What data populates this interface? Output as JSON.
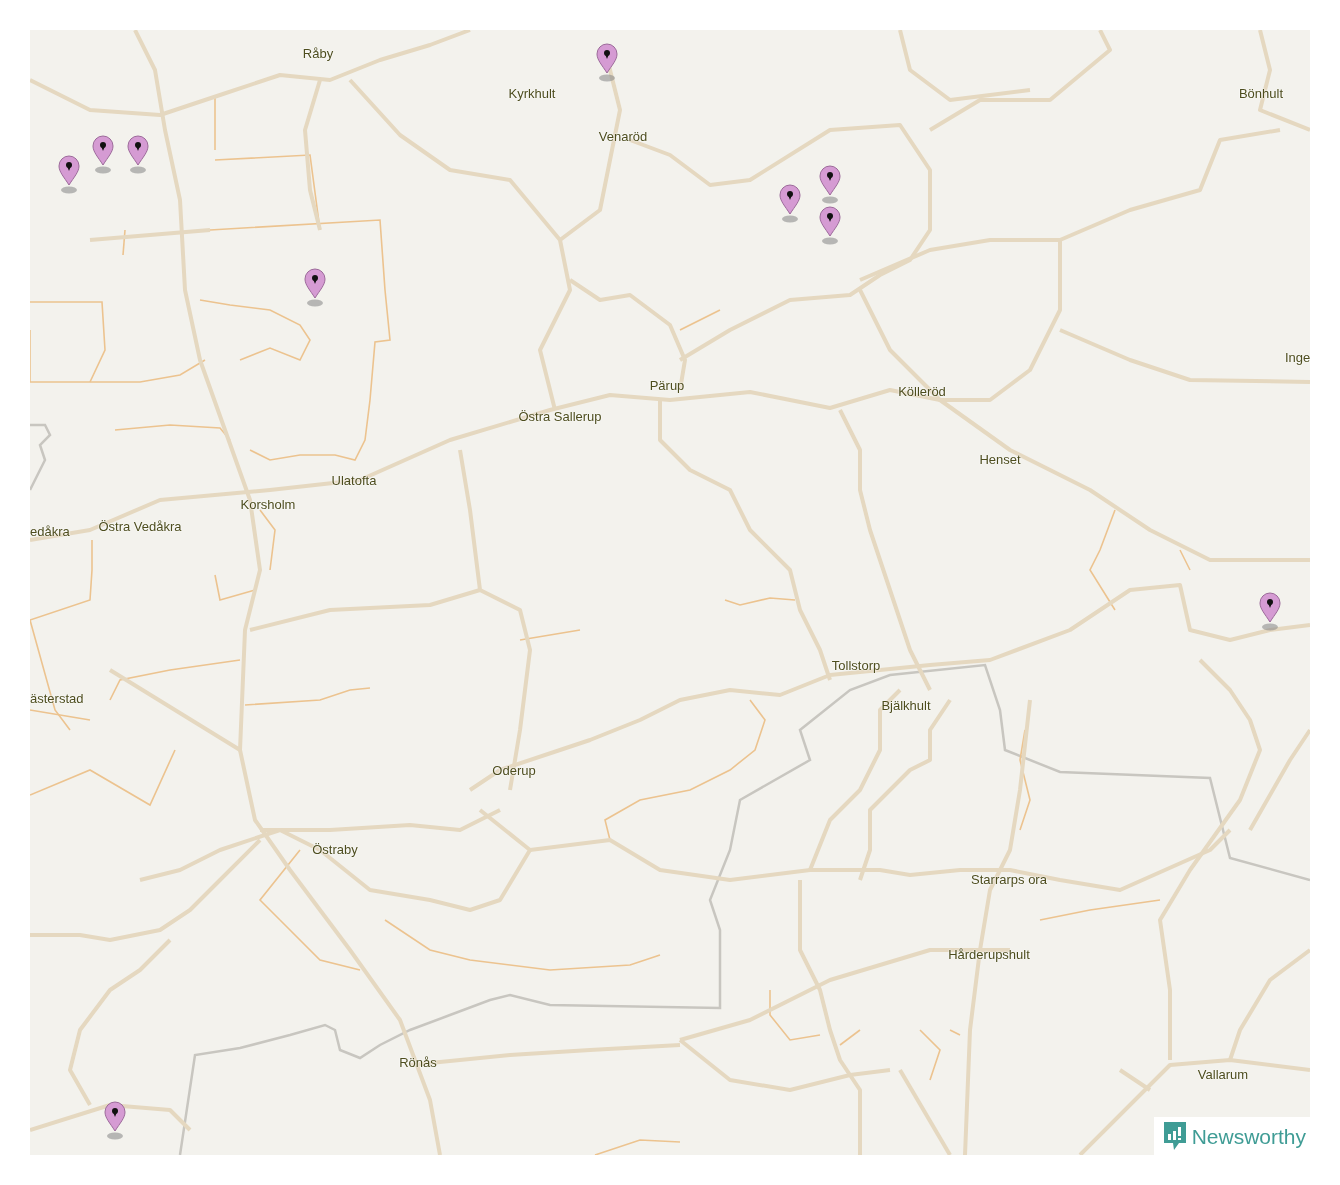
{
  "map": {
    "places": [
      {
        "name": "Råby"
      },
      {
        "name": "Kyrkhult"
      },
      {
        "name": "Venaröd"
      },
      {
        "name": "Bönhult"
      },
      {
        "name": "Inge"
      },
      {
        "name": "Pärup"
      },
      {
        "name": "Kölleröd"
      },
      {
        "name": "Östra Sallerup"
      },
      {
        "name": "Henset"
      },
      {
        "name": "Ulatofta"
      },
      {
        "name": "Korsholm"
      },
      {
        "name": "edåkra"
      },
      {
        "name": "Östra Vedåkra"
      },
      {
        "name": "Tollstorp"
      },
      {
        "name": "Bjälkhult"
      },
      {
        "name": "ästerstad"
      },
      {
        "name": "Oderup"
      },
      {
        "name": "Östraby"
      },
      {
        "name": "Starrarps ora"
      },
      {
        "name": "Hårderupshult"
      },
      {
        "name": "Rönås"
      },
      {
        "name": "Vallarum"
      }
    ]
  },
  "brand": {
    "name": "Newsworthy"
  }
}
